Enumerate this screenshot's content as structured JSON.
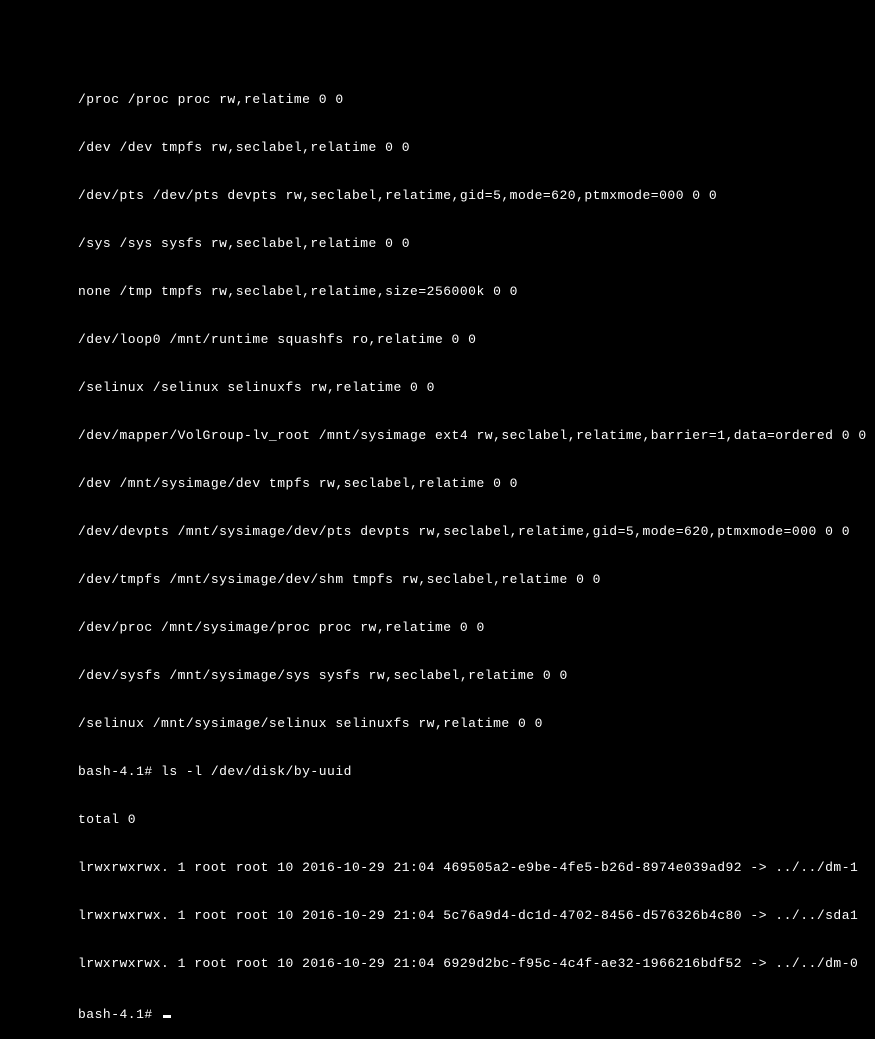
{
  "terminal": {
    "lines": [
      "/proc /proc proc rw,relatime 0 0",
      "/dev /dev tmpfs rw,seclabel,relatime 0 0",
      "/dev/pts /dev/pts devpts rw,seclabel,relatime,gid=5,mode=620,ptmxmode=000 0 0",
      "/sys /sys sysfs rw,seclabel,relatime 0 0",
      "none /tmp tmpfs rw,seclabel,relatime,size=256000k 0 0",
      "/dev/loop0 /mnt/runtime squashfs ro,relatime 0 0",
      "/selinux /selinux selinuxfs rw,relatime 0 0",
      "/dev/mapper/VolGroup-lv_root /mnt/sysimage ext4 rw,seclabel,relatime,barrier=1,data=ordered 0 0",
      "/dev /mnt/sysimage/dev tmpfs rw,seclabel,relatime 0 0",
      "/dev/devpts /mnt/sysimage/dev/pts devpts rw,seclabel,relatime,gid=5,mode=620,ptmxmode=000 0 0",
      "/dev/tmpfs /mnt/sysimage/dev/shm tmpfs rw,seclabel,relatime 0 0",
      "/dev/proc /mnt/sysimage/proc proc rw,relatime 0 0",
      "/dev/sysfs /mnt/sysimage/sys sysfs rw,seclabel,relatime 0 0",
      "/selinux /mnt/sysimage/selinux selinuxfs rw,relatime 0 0",
      "bash-4.1# ls -l /dev/disk/by-uuid",
      "total 0",
      "lrwxrwxrwx. 1 root root 10 2016-10-29 21:04 469505a2-e9be-4fe5-b26d-8974e039ad92 -> ../../dm-1",
      "lrwxrwxrwx. 1 root root 10 2016-10-29 21:04 5c76a9d4-dc1d-4702-8456-d576326b4c80 -> ../../sda1",
      "lrwxrwxrwx. 1 root root 10 2016-10-29 21:04 6929d2bc-f95c-4c4f-ae32-1966216bdf52 -> ../../dm-0"
    ],
    "prompt": "bash-4.1# "
  }
}
